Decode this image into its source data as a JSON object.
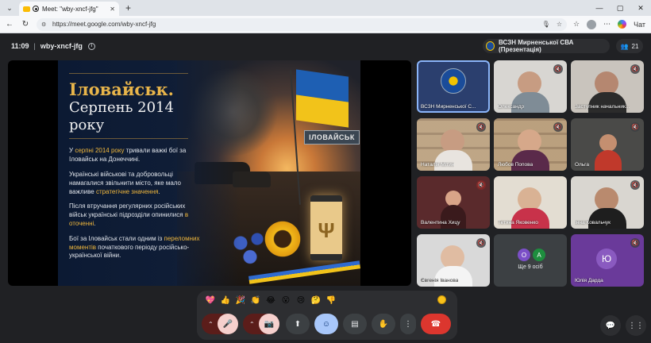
{
  "browser": {
    "tab_title": "Meet: \"wby-xncf-jfg\"",
    "tab_close": "✕",
    "new_tab": "+",
    "url": "https://meet.google.com/wby-xncf-jfg",
    "chat_label": "Чат",
    "win_min": "—",
    "win_max": "▢",
    "win_close": "✕"
  },
  "meet": {
    "time": "11:09",
    "code": "wby-xncf-jfg",
    "presenter_chip": "ВСЗН Мирненської СВА (Презентація)",
    "people_count": "21"
  },
  "slide": {
    "title_1": "Іловайськ.",
    "title_2": "Серпень 2014 року",
    "sign_text": "ІЛОВАЙСЬК",
    "p1_a": "У ",
    "p1_hl": "серпні 2014 року",
    "p1_b": " тривали важкі бої за Іловайськ на Донеччині.",
    "p2_a": "Українські військові та добровольці намагалися звільнити місто, яке мало важливе ",
    "p2_hl": "стратегічне значення",
    "p2_b": ".",
    "p3_a": "Після втручання регулярних російських військ українські підрозділи опинилися ",
    "p3_hl": "в оточенні",
    "p3_b": ".",
    "p4_a": "Бої за Іловайськ стали одним із ",
    "p4_hl": "переломних моментів",
    "p4_b": " початкового періоду російсько-української війни."
  },
  "participants": [
    {
      "name": "ВСЗН Мирненської С..."
    },
    {
      "name": "Олександр"
    },
    {
      "name": "Заступник начальник..."
    },
    {
      "name": "Наталія Мітин"
    },
    {
      "name": "Любов Попова"
    },
    {
      "name": "Ольга"
    },
    {
      "name": "Валентина Хицу"
    },
    {
      "name": "Тетяна Яковенко"
    },
    {
      "name": "Інна Ковальчук"
    },
    {
      "name": "Євгенія Іванова"
    },
    {
      "name": "Ще 9 осіб",
      "initial_1": "О",
      "initial_2": "А"
    },
    {
      "name": "Юлія Дарда",
      "initial": "Ю"
    }
  ],
  "reactions": [
    "💖",
    "👍",
    "🎉",
    "👏",
    "😂",
    "😮",
    "😢",
    "🤔",
    "👎"
  ],
  "colors": {
    "accent_highlight": "#f0b73c",
    "hangup": "#dc362e",
    "active_speaker": "#8ab4f8"
  }
}
